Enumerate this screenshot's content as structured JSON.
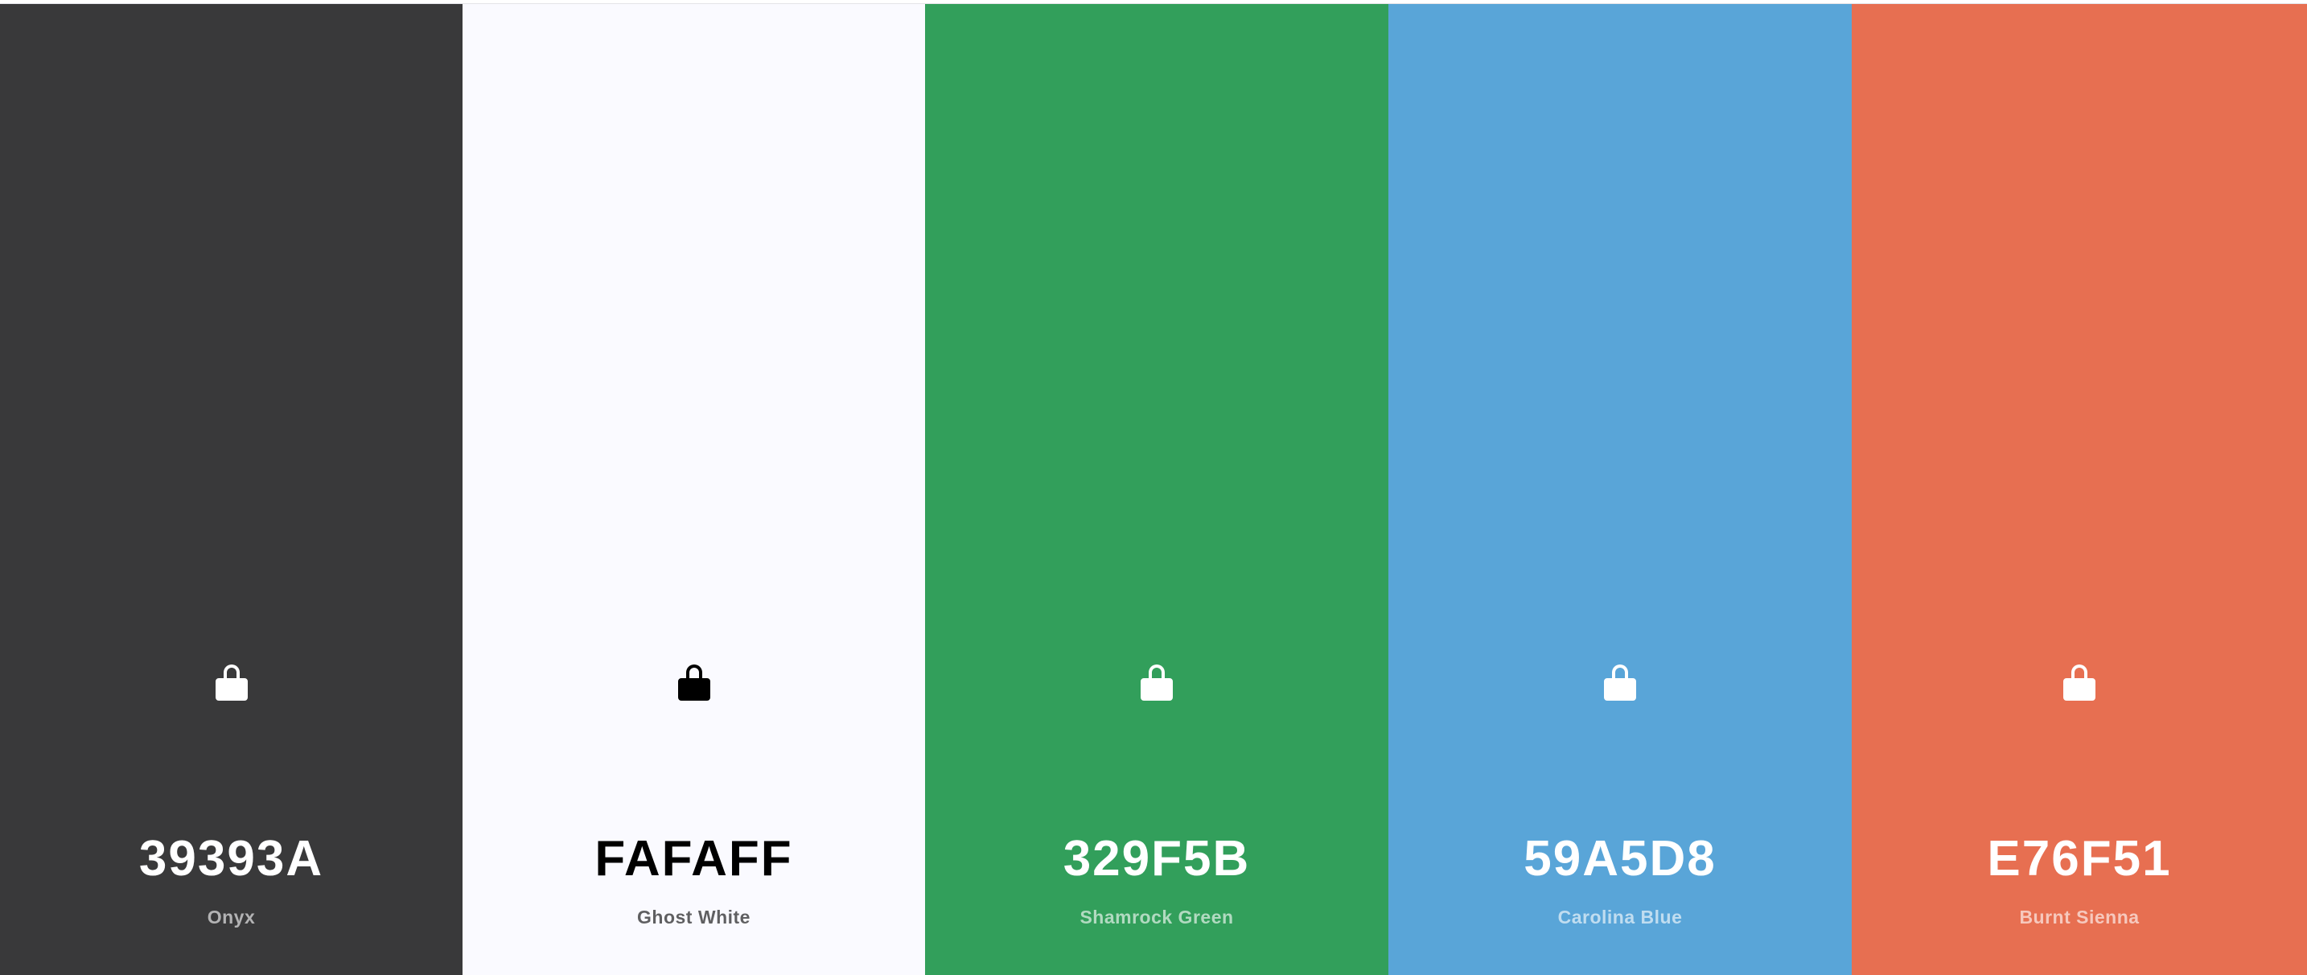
{
  "palette": {
    "swatches": [
      {
        "hex": "39393A",
        "name": "Onyx",
        "color": "#39393A",
        "text_tone": "light",
        "lock_icon": "lock-icon"
      },
      {
        "hex": "FAFAFF",
        "name": "Ghost White",
        "color": "#FAFAFF",
        "text_tone": "dark",
        "lock_icon": "lock-icon"
      },
      {
        "hex": "329F5B",
        "name": "Shamrock Green",
        "color": "#329F5B",
        "text_tone": "light",
        "lock_icon": "lock-icon"
      },
      {
        "hex": "59A5D8",
        "name": "Carolina Blue",
        "color": "#59A5D8",
        "text_tone": "light",
        "lock_icon": "lock-icon"
      },
      {
        "hex": "E76F51",
        "name": "Burnt Sienna",
        "color": "#E76F51",
        "text_tone": "light",
        "lock_icon": "lock-icon"
      }
    ]
  }
}
